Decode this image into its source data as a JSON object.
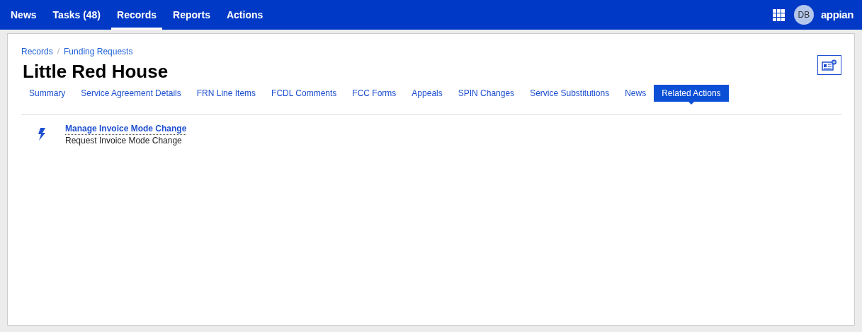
{
  "nav": {
    "items": [
      {
        "label": "News",
        "selected": false
      },
      {
        "label": "Tasks (48)",
        "selected": false
      },
      {
        "label": "Records",
        "selected": true
      },
      {
        "label": "Reports",
        "selected": false
      },
      {
        "label": "Actions",
        "selected": false
      }
    ],
    "avatar": "DB",
    "logo": "appian"
  },
  "breadcrumbs": [
    "Records",
    "Funding Requests"
  ],
  "breadcrumb_separator": "/",
  "title": "Little Red House",
  "tabs": [
    {
      "label": "Summary",
      "selected": false
    },
    {
      "label": "Service Agreement Details",
      "selected": false
    },
    {
      "label": "FRN Line Items",
      "selected": false
    },
    {
      "label": "FCDL Comments",
      "selected": false
    },
    {
      "label": "FCC Forms",
      "selected": false
    },
    {
      "label": "Appeals",
      "selected": false
    },
    {
      "label": "SPIN Changes",
      "selected": false
    },
    {
      "label": "Service Substitutions",
      "selected": false
    },
    {
      "label": "News",
      "selected": false
    },
    {
      "label": "Related Actions",
      "selected": true
    }
  ],
  "actions": [
    {
      "title": "Manage Invoice Mode Change",
      "description": "Request Invoice Mode Change"
    }
  ]
}
